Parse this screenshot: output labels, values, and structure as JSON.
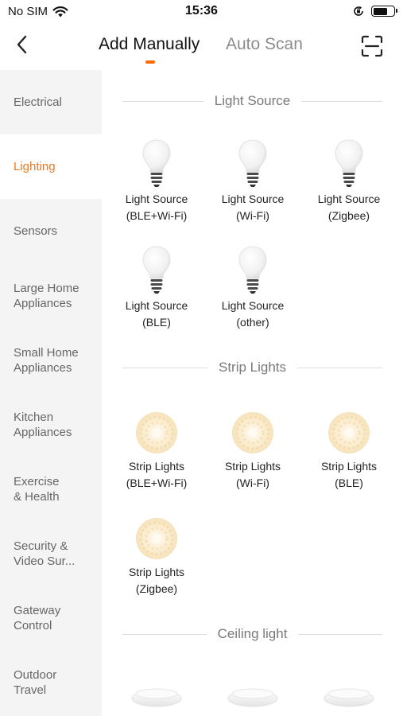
{
  "status_bar": {
    "carrier": "No SIM",
    "time": "15:36",
    "wifi_icon": "wifi-icon",
    "battery_icon": "battery-icon",
    "orientation_icon": "orientation-lock-icon"
  },
  "nav": {
    "back_icon": "chevron-left-icon",
    "tab_manual": "Add Manually",
    "tab_auto": "Auto Scan",
    "scan_icon": "scan-icon",
    "active_tab": "Add Manually",
    "accent_color": "#ff6a00"
  },
  "sidebar": {
    "active_color": "#e87a24",
    "items": [
      {
        "label": "Electrical",
        "active": false
      },
      {
        "label": "Lighting",
        "active": true
      },
      {
        "label": "Sensors",
        "active": false
      },
      {
        "label": "Large Home\nAppliances",
        "active": false
      },
      {
        "label": "Small Home\nAppliances",
        "active": false
      },
      {
        "label": "Kitchen\nAppliances",
        "active": false
      },
      {
        "label": "Exercise\n& Health",
        "active": false
      },
      {
        "label": "Security &\nVideo Sur...",
        "active": false
      },
      {
        "label": "Gateway\nControl",
        "active": false
      },
      {
        "label": "Outdoor\nTravel",
        "active": false
      }
    ]
  },
  "sections": [
    {
      "title": "Light Source",
      "icon": "light-bulb-icon",
      "devices": [
        {
          "label": "Light Source\n(BLE+Wi-Fi)"
        },
        {
          "label": "Light Source\n(Wi-Fi)"
        },
        {
          "label": "Light Source\n(Zigbee)"
        },
        {
          "label": "Light Source\n(BLE)"
        },
        {
          "label": "Light Source\n(other)"
        }
      ]
    },
    {
      "title": "Strip Lights",
      "icon": "strip-light-icon",
      "devices": [
        {
          "label": "Strip Lights\n(BLE+Wi-Fi)"
        },
        {
          "label": "Strip Lights\n(Wi-Fi)"
        },
        {
          "label": "Strip Lights\n(BLE)"
        },
        {
          "label": "Strip Lights\n(Zigbee)"
        }
      ]
    },
    {
      "title": "Ceiling light",
      "icon": "ceiling-light-icon",
      "devices": [
        {
          "label": ""
        },
        {
          "label": ""
        },
        {
          "label": ""
        }
      ]
    }
  ]
}
